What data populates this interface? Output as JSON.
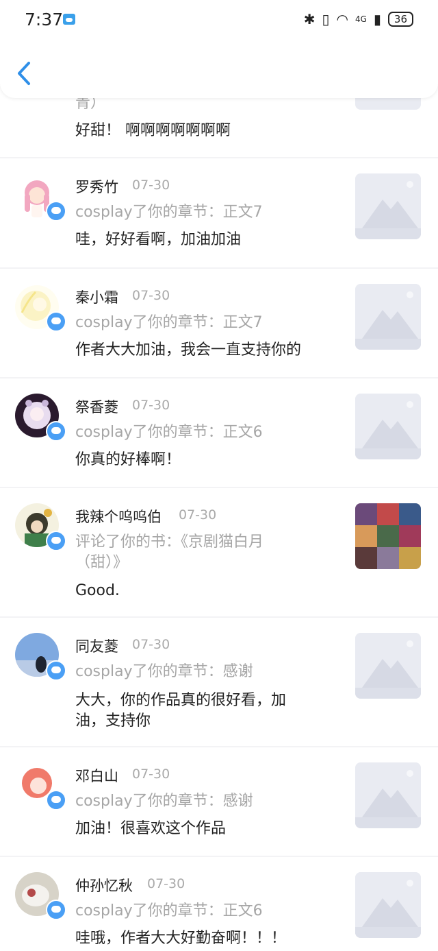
{
  "status": {
    "time": "7:37",
    "network": "4G",
    "battery": "36"
  },
  "partial_top": {
    "name_tail": "青）",
    "comment": "好甜！ 啊啊啊啊啊啊啊"
  },
  "items": [
    {
      "name": "罗秀竹",
      "date": "07-30",
      "action": "cosplay了你的章节：正文7",
      "comment": "哇，好好看啊，加油加油"
    },
    {
      "name": "秦小霜",
      "date": "07-30",
      "action": "cosplay了你的章节：正文7",
      "comment": "作者大大加油，我会一直支持你的"
    },
    {
      "name": "祭香菱",
      "date": "07-30",
      "action": "cosplay了你的章节：正文6",
      "comment": "你真的好棒啊！"
    },
    {
      "name": "我辣个呜呜伯",
      "date": "07-30",
      "action": "评论了你的书：《京剧猫白月（甜）》",
      "comment": "Good."
    },
    {
      "name": "同友菱",
      "date": "07-30",
      "action": "cosplay了你的章节：感谢",
      "comment": "大大，你的作品真的很好看，加油，支持你"
    },
    {
      "name": "邓白山",
      "date": "07-30",
      "action": "cosplay了你的章节：感谢",
      "comment": "加油！很喜欢这个作品"
    },
    {
      "name": "仲孙忆秋",
      "date": "07-30",
      "action": "cosplay了你的章节：正文6",
      "comment": "哇哦，作者大大好勤奋啊！！！"
    }
  ],
  "icons": {
    "back": "chevron-left-icon",
    "badge": "comment-bubble-icon",
    "thumb_placeholder": "mountain-placeholder-icon"
  },
  "colors": {
    "accent": "#4a9ff5",
    "back_arrow": "#2f8fe8",
    "muted_text": "#a6a6a6"
  }
}
